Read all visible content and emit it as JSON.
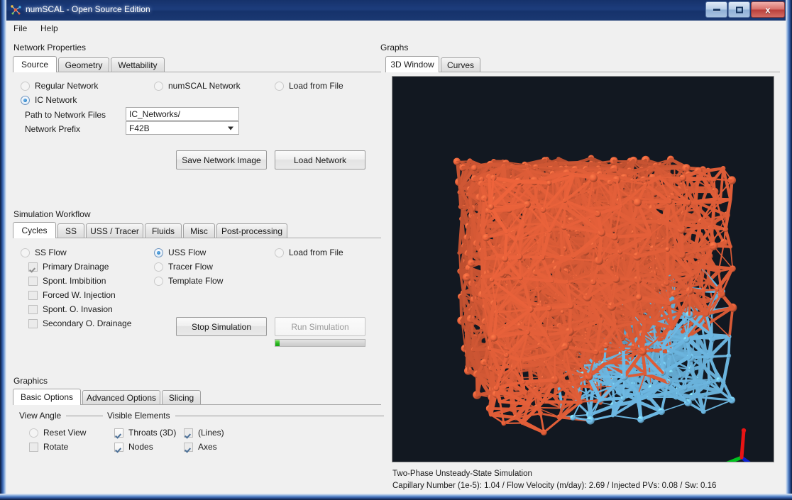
{
  "window": {
    "title": "numSCAL - Open Source Edition",
    "icon": "numscal-app-icon",
    "minimize_label": "",
    "maximize_label": "",
    "close_label": "x",
    "accent_titlebar": "#1d3d7d"
  },
  "menubar": {
    "items": [
      {
        "label": "File"
      },
      {
        "label": "Help"
      }
    ]
  },
  "network_properties": {
    "group_label": "Network Properties",
    "tabs": [
      {
        "label": "Source",
        "selected": true
      },
      {
        "label": "Geometry",
        "selected": false
      },
      {
        "label": "Wettability",
        "selected": false
      }
    ],
    "radios": [
      {
        "label": "Regular Network",
        "selected": false
      },
      {
        "label": "numSCAL Network",
        "selected": false
      },
      {
        "label": "Load  from File",
        "selected": false
      },
      {
        "label": "IC Network",
        "selected": true
      }
    ],
    "fields": [
      {
        "label": "Path to Network Files",
        "value": "IC_Networks/",
        "placeholder": "",
        "type": "text"
      },
      {
        "label": "Network Prefix",
        "value": "F42B",
        "placeholder": "",
        "type": "combo"
      }
    ],
    "buttons": [
      {
        "label": "Save Network Image",
        "enabled": true
      },
      {
        "label": "Load Network",
        "enabled": true
      }
    ]
  },
  "simulation_workflow": {
    "group_label": "Simulation Workflow",
    "tabs": [
      {
        "label": "Cycles",
        "selected": true
      },
      {
        "label": "SS",
        "selected": false
      },
      {
        "label": "USS / Tracer",
        "selected": false
      },
      {
        "label": "Fluids",
        "selected": false
      },
      {
        "label": "Misc",
        "selected": false
      },
      {
        "label": "Post-processing",
        "selected": false
      }
    ],
    "flow_radios_col1": [
      {
        "label": "SS Flow",
        "selected": false
      }
    ],
    "cycle_checkboxes": [
      {
        "label": "Primary Drainage",
        "checked": true
      },
      {
        "label": "Spont. Imbibition",
        "checked": false
      },
      {
        "label": "Forced W. Injection",
        "checked": false
      },
      {
        "label": "Spont. O. Invasion",
        "checked": false
      },
      {
        "label": "Secondary O. Drainage",
        "checked": false
      }
    ],
    "flow_radios_col2": [
      {
        "label": "USS Flow",
        "selected": true
      },
      {
        "label": "Tracer Flow",
        "selected": false
      },
      {
        "label": "Template Flow",
        "selected": false
      }
    ],
    "flow_radios_col3": [
      {
        "label": "Load  from File",
        "selected": false
      }
    ],
    "buttons": [
      {
        "label": "Stop Simulation",
        "enabled": true
      },
      {
        "label": "Run Simulation",
        "enabled": false
      }
    ],
    "progress": {
      "value": 5,
      "max": 100,
      "color": "#22b31b"
    }
  },
  "graphics": {
    "group_label": "Graphics",
    "tabs": [
      {
        "label": "Basic Options",
        "selected": true
      },
      {
        "label": "Advanced Options",
        "selected": false
      },
      {
        "label": "Slicing",
        "selected": false
      }
    ],
    "sections": [
      {
        "label": "View Angle"
      },
      {
        "label": "Visible Elements"
      }
    ],
    "view_angle": [
      {
        "label": "Reset View",
        "type": "radio",
        "selected": false
      },
      {
        "label": "Rotate",
        "type": "checkbox",
        "checked": false
      }
    ],
    "visible_elements_col1": [
      {
        "label": "Throats (3D)",
        "checked": true
      },
      {
        "label": "Nodes",
        "checked": true
      }
    ],
    "visible_elements_col2": [
      {
        "label": "(Lines)",
        "checked": true
      },
      {
        "label": "Axes",
        "checked": true
      }
    ]
  },
  "graphs": {
    "group_label": "Graphs",
    "tabs": [
      {
        "label": "3D Window",
        "selected": true
      },
      {
        "label": "Curves",
        "selected": false
      }
    ],
    "viewport": {
      "background": "#121821",
      "oil_color": "#e8613a",
      "water_color": "#73c2ef",
      "axes": {
        "x_color": "#0a1fd0",
        "y_color": "#00c31e",
        "z_color": "#e81414"
      }
    },
    "status": {
      "line1": "Two-Phase Unsteady-State Simulation",
      "line2": "Capillary Number (1e-5): 1.04 / Flow Velocity (m/day): 2.69 / Injected PVs: 0.08 / Sw: 0.16"
    }
  }
}
